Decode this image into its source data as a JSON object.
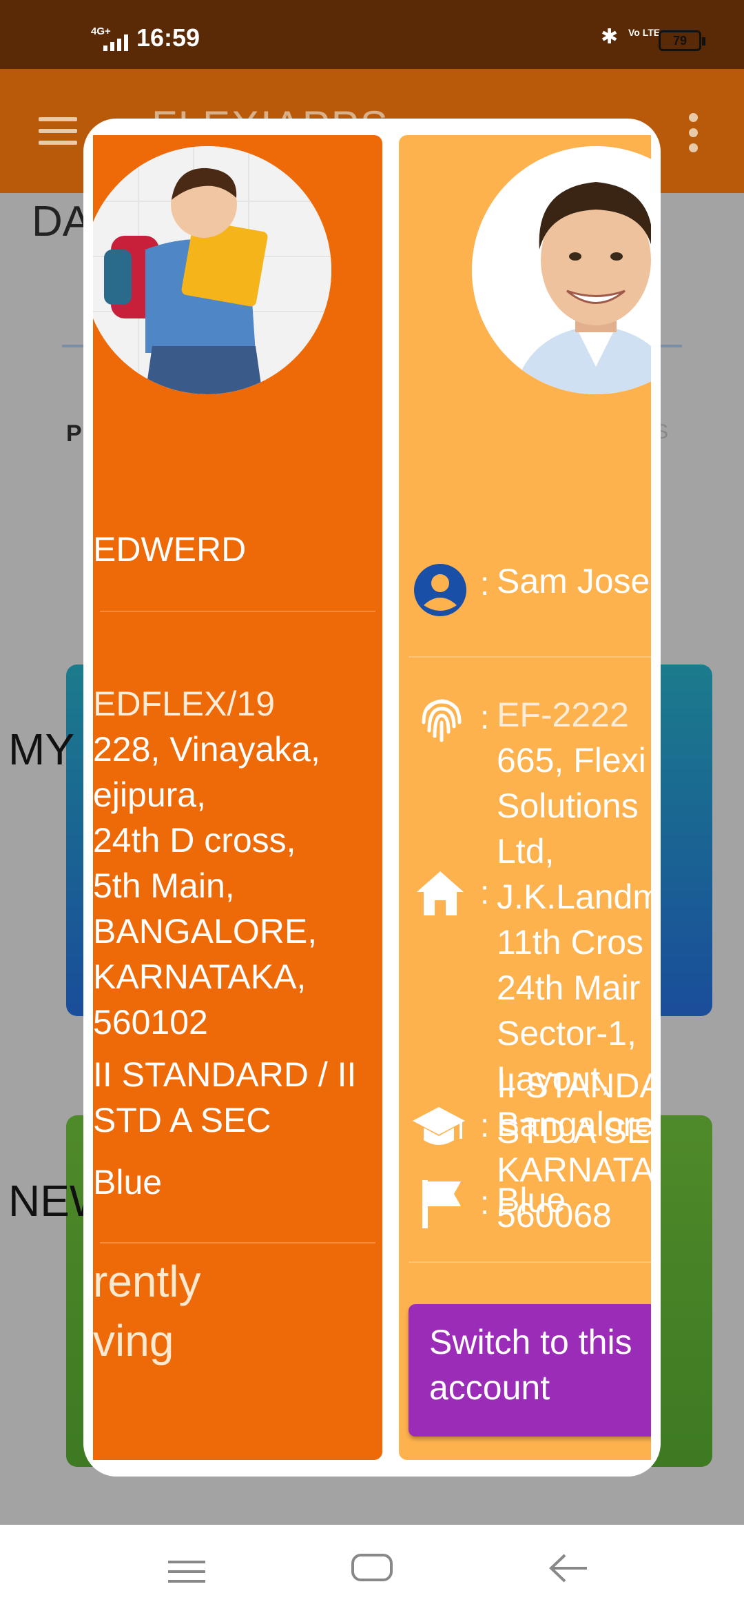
{
  "status_bar": {
    "network": "4G+",
    "time": "16:59",
    "volte": "Vo LTE",
    "battery": "79"
  },
  "app_bar": {
    "title": "FLEXIAPPS"
  },
  "background": {
    "section_da": "DA",
    "tab_p": "P",
    "tab_s": "S",
    "section_my": "MY",
    "section_new": "NEW"
  },
  "profiles": [
    {
      "name": "EDWERD",
      "id": "EDFLEX/19",
      "address": "228, Vinayaka,\nejipura,\n24th D cross,\n5th Main,\nBANGALORE,\nKARNATAKA,\n560102",
      "class": "II STANDARD / II\nSTD A SEC",
      "house": "Blue",
      "status": "rently\nving"
    },
    {
      "name": "Sam Josep",
      "id": "EF-2222",
      "address": "665, Flexi\nSolutions\nLtd,\nJ.K.Landm\n11th Cros\n24th Mair\nSector-1,\nLayout,\nBangalore\nKARNATA\n560068",
      "class": "II STANDA\nSTD A SEC",
      "house": "Blue",
      "switch_label": "Switch to this\naccount"
    }
  ],
  "colors": {
    "card_active": "#ee6a08",
    "card_other": "#fdb24e",
    "switch_button": "#9b2cb8",
    "icon_blue": "#1a4fa8"
  }
}
